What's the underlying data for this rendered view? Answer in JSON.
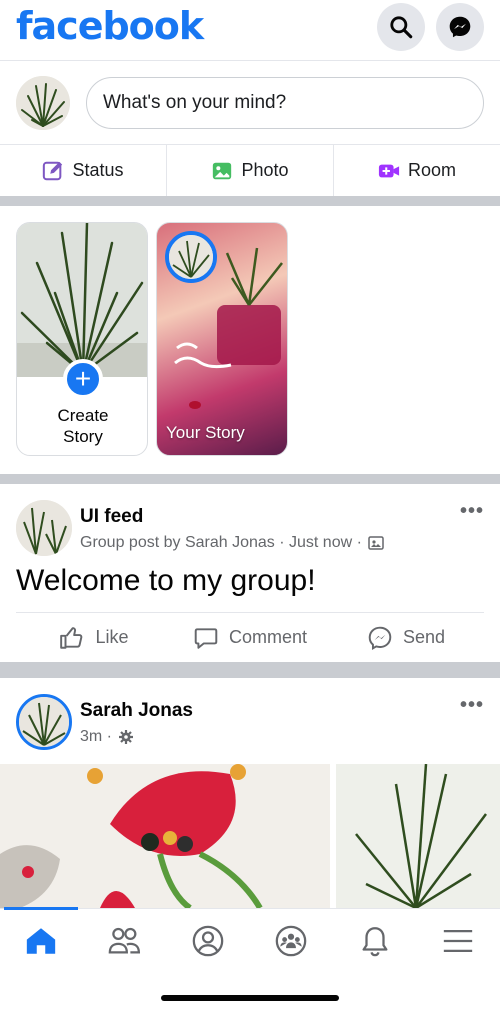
{
  "app": {
    "logo": "facebook"
  },
  "header": {
    "search_icon": "search-icon",
    "messenger_icon": "messenger-icon"
  },
  "composer": {
    "placeholder": "What's on your mind?"
  },
  "composer_actions": [
    {
      "label": "Status",
      "icon": "edit-icon",
      "color": "#7e57c2"
    },
    {
      "label": "Photo",
      "icon": "photo-icon",
      "color": "#45bd62"
    },
    {
      "label": "Room",
      "icon": "video-room-icon",
      "color": "#a033ff"
    }
  ],
  "stories": {
    "create": {
      "label_line1": "Create",
      "label_line2": "Story"
    },
    "your_story": {
      "label": "Your Story"
    }
  },
  "post1": {
    "title": "UI feed",
    "meta": "Group post by Sarah Jonas · Just now ·",
    "text": "Welcome to my group!",
    "actions": {
      "like": "Like",
      "comment": "Comment",
      "send": "Send"
    }
  },
  "post2": {
    "author": "Sarah Jonas",
    "time": "3m ·"
  },
  "colors": {
    "brand": "#1877f2",
    "muted": "#65676b",
    "separator": "#c9ccd1"
  }
}
